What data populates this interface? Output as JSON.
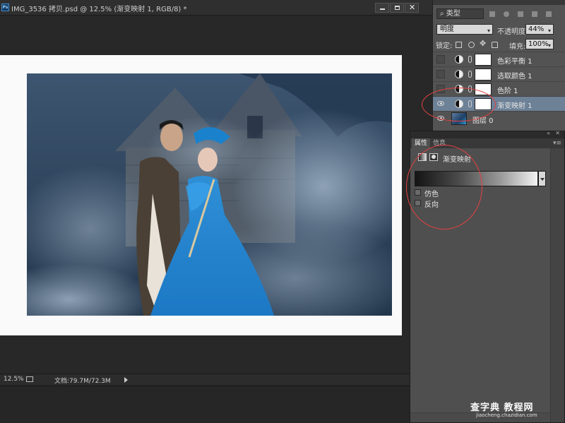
{
  "document": {
    "title": "IMG_3536 拷贝.psd @ 12.5% (渐变映射 1, RGB/8) *",
    "ps_icon_label": "Ps"
  },
  "status_bar": {
    "zoom": "12.5%",
    "doc_size": "文档:79.7M/72.3M"
  },
  "layers_panel": {
    "filter_kind": "类型",
    "blend_mode": "明度",
    "opacity_label": "不透明度:",
    "opacity_value": "44%",
    "lock_label": "锁定:",
    "fill_label": "填充:",
    "fill_value": "100%",
    "layers": [
      {
        "name": "色彩平衡 1",
        "visible": false,
        "selected": false
      },
      {
        "name": "选取颜色 1",
        "visible": false,
        "selected": false
      },
      {
        "name": "色阶 1",
        "visible": false,
        "selected": false
      },
      {
        "name": "渐变映射 1",
        "visible": true,
        "selected": true
      },
      {
        "name": "图层 0",
        "visible": true,
        "selected": false
      }
    ]
  },
  "properties_panel": {
    "tabs": [
      "属性",
      "信息"
    ],
    "active_tab": "属性",
    "title": "渐变映射",
    "gradient_stops": [
      "#141414",
      "#f2f2f2"
    ],
    "options": [
      {
        "label": "仿色",
        "checked": false
      },
      {
        "label": "反向",
        "checked": false
      }
    ]
  },
  "watermark": {
    "main": "查字典 教程网",
    "sub": "jiaocheng.chazidian.com"
  },
  "colors": {
    "panel_bg": "#535353",
    "selected_layer": "#6d8197",
    "annotation": "#e64040"
  }
}
